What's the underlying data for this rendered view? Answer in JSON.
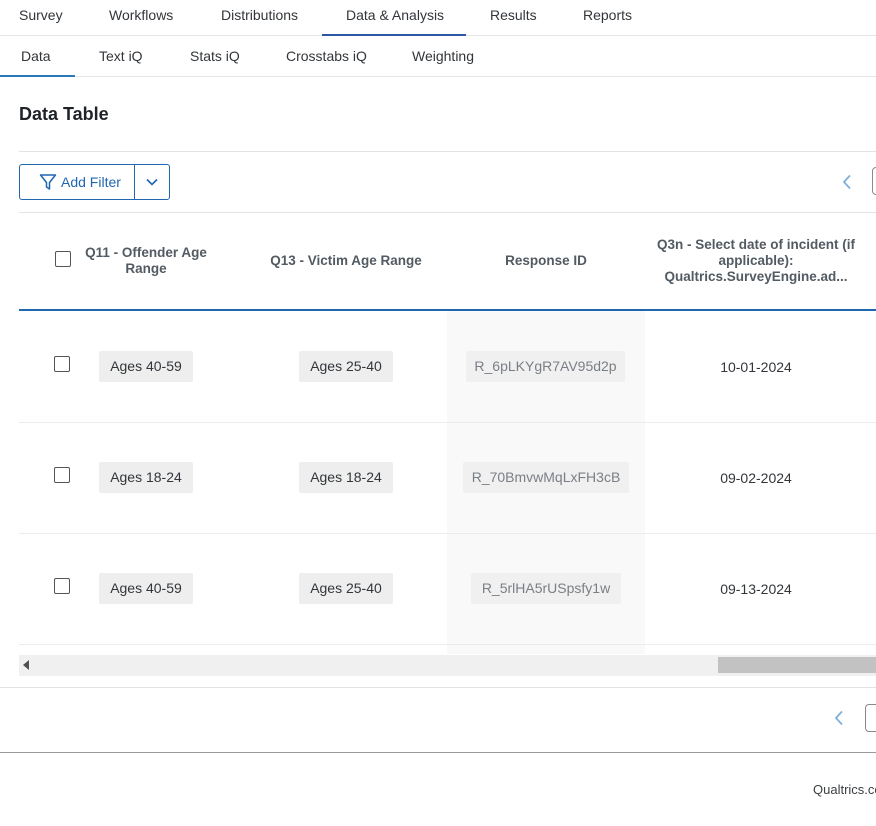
{
  "topnav": {
    "tabs": [
      {
        "label": "Survey"
      },
      {
        "label": "Workflows"
      },
      {
        "label": "Distributions"
      },
      {
        "label": "Data & Analysis",
        "active": true
      },
      {
        "label": "Results"
      },
      {
        "label": "Reports"
      }
    ]
  },
  "subnav": {
    "tabs": [
      {
        "label": "Data",
        "active": true
      },
      {
        "label": "Text iQ"
      },
      {
        "label": "Stats iQ"
      },
      {
        "label": "Crosstabs iQ"
      },
      {
        "label": "Weighting"
      }
    ]
  },
  "page": {
    "title": "Data Table"
  },
  "toolbar": {
    "filter_label": "Add Filter",
    "filter_icon": "funnel-icon",
    "dropdown_icon": "chevron-down-icon"
  },
  "table": {
    "headers": [
      "Q11 - Offender Age Range",
      "Q13 - Victim Age Range",
      "Response ID",
      "Q3n - Select date of incident (if applicable): Qualtrics.SurveyEngine.ad..."
    ],
    "rows": [
      {
        "offender": "Ages 40-59",
        "victim": "Ages 25-40",
        "response_id": "R_6pLKYgR7AV95d2p",
        "date": "10-01-2024"
      },
      {
        "offender": "Ages 18-24",
        "victim": "Ages 18-24",
        "response_id": "R_70BmvwMqLxFH3cB",
        "date": "09-02-2024"
      },
      {
        "offender": "Ages 40-59",
        "victim": "Ages 25-40",
        "response_id": "R_5rlHA5rUSpsfy1w",
        "date": "09-13-2024"
      }
    ]
  },
  "footer": {
    "text": "Qualtrics.co"
  },
  "colors": {
    "accent": "#2067b0",
    "nav_active": "#2c57a7",
    "pager_arrow": "#7fb0dc"
  }
}
